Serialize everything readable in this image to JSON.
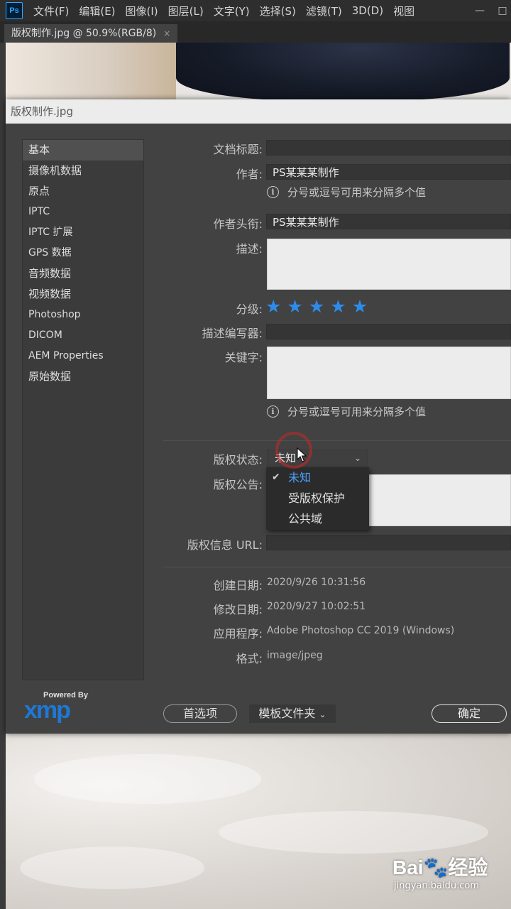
{
  "app": {
    "logo_text": "Ps",
    "menu": [
      "文件(F)",
      "编辑(E)",
      "图像(I)",
      "图层(L)",
      "文字(Y)",
      "选择(S)",
      "滤镜(T)",
      "3D(D)",
      "视图"
    ],
    "window_controls": {
      "minimize": "—",
      "maximize": "□"
    }
  },
  "document_tab": {
    "title": "版权制作.jpg @ 50.9%(RGB/8)",
    "close": "×"
  },
  "dialog": {
    "title": "版权制作.jpg",
    "categories": [
      "基本",
      "摄像机数据",
      "原点",
      "IPTC",
      "IPTC 扩展",
      "GPS 数据",
      "音频数据",
      "视频数据",
      "Photoshop",
      "DICOM",
      "AEM Properties",
      "原始数据"
    ],
    "selected_category": "基本",
    "fields": {
      "doc_title_label": "文档标题:",
      "doc_title_value": "",
      "author_label": "作者:",
      "author_value": "PS某某某制作",
      "author_hint": "分号或逗号可用来分隔多个值",
      "author_title_label": "作者头衔:",
      "author_title_value": "PS某某某制作",
      "description_label": "描述:",
      "rating_label": "分级:",
      "rating": 5,
      "desc_writer_label": "描述编写器:",
      "keywords_label": "关键字:",
      "keywords_hint": "分号或逗号可用来分隔多个值",
      "copyright_status_label": "版权状态:",
      "copyright_status_value": "未知",
      "copyright_notice_label": "版权公告:",
      "copyright_url_label": "版权信息 URL:",
      "created_label": "创建日期:",
      "created_value": "2020/9/26 10:31:56",
      "modified_label": "修改日期:",
      "modified_value": "2020/9/27 10:02:51",
      "application_label": "应用程序:",
      "application_value": "Adobe Photoshop CC 2019 (Windows)",
      "format_label": "格式:",
      "format_value": "image/jpeg"
    },
    "copyright_dropdown": {
      "options": [
        "未知",
        "受版权保护",
        "公共域"
      ],
      "selected": "未知"
    },
    "xmp": {
      "powered_by": "Powered By",
      "word": "xmp"
    },
    "buttons": {
      "preferences": "首选项",
      "template_folder": "模板文件夹",
      "ok": "确定"
    }
  },
  "watermark": {
    "main": "Bai🐾经验",
    "sub": "jingyan.baidu.com"
  },
  "colors": {
    "accent": "#2d8ceb",
    "selected_text": "#4aa3ff",
    "xmp_blue": "#1d78d6"
  }
}
